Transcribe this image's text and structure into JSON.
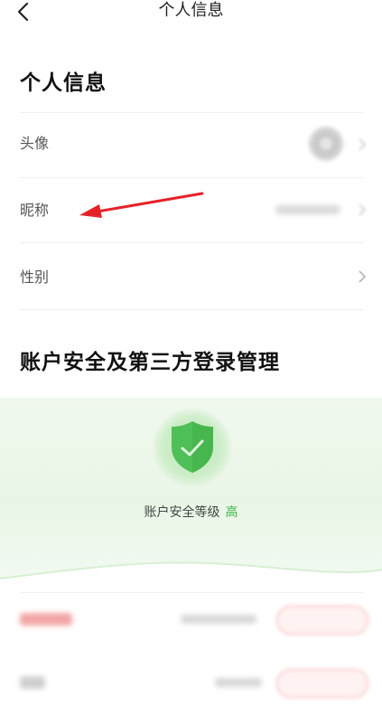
{
  "nav": {
    "title": "个人信息"
  },
  "personal": {
    "title": "个人信息",
    "rows": [
      {
        "label": "头像"
      },
      {
        "label": "昵称"
      },
      {
        "label": "性别"
      }
    ]
  },
  "security": {
    "title": "账户安全及第三方登录管理",
    "level_label": "账户安全等级",
    "level_value": "高"
  },
  "colors": {
    "accent_green": "#3cb44b",
    "shield_green": "#4fbf57",
    "annotation_red": "#e5222a"
  },
  "icons": [
    "back-arrow-icon",
    "chevron-right-icon",
    "shield-check-icon"
  ]
}
